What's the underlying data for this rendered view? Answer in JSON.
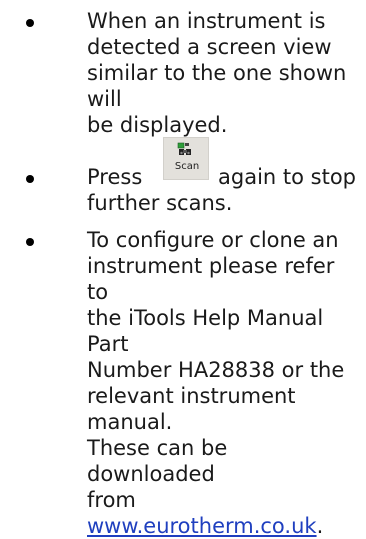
{
  "items": [
    {
      "lines": [
        "When an instrument is",
        "detected a screen view",
        "similar to the one shown will",
        "be displayed."
      ]
    },
    {
      "prefix": "Press",
      "button_label": "Scan",
      "suffix": "again to stop",
      "line2": "further scans."
    },
    {
      "lines": [
        "To configure or clone an",
        "instrument please refer to",
        "the iTools Help Manual Part",
        "Number HA28838 or the",
        "relevant instrument manual.",
        "These can be downloaded"
      ],
      "last_prefix": "from ",
      "link": "www.eurotherm.co.uk",
      "last_suffix": "."
    }
  ],
  "colors": {
    "link": "#1f3fbf",
    "button_bg": "#e3e1dc"
  }
}
